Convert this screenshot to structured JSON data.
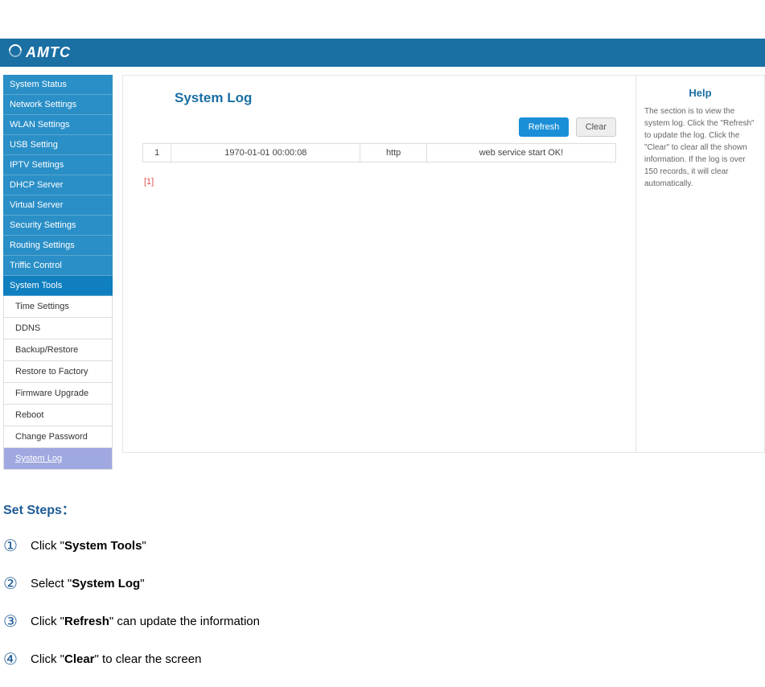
{
  "brand": "AMTC",
  "sidebar": {
    "items": [
      {
        "label": "System Status"
      },
      {
        "label": "Network Settings"
      },
      {
        "label": "WLAN Settings"
      },
      {
        "label": "USB Setting"
      },
      {
        "label": "IPTV Settings"
      },
      {
        "label": "DHCP Server"
      },
      {
        "label": "Virtual Server"
      },
      {
        "label": "Security Settings"
      },
      {
        "label": "Routing Settings"
      },
      {
        "label": "Triffic Control"
      },
      {
        "label": "System Tools"
      }
    ],
    "subitems": [
      {
        "label": "Time Settings"
      },
      {
        "label": "DDNS"
      },
      {
        "label": "Backup/Restore"
      },
      {
        "label": "Restore to Factory"
      },
      {
        "label": "Firmware Upgrade"
      },
      {
        "label": "Reboot"
      },
      {
        "label": "Change Password"
      },
      {
        "label": "System Log"
      }
    ]
  },
  "main": {
    "title": "System Log",
    "buttons": {
      "refresh": "Refresh",
      "clear": "Clear"
    },
    "log": {
      "row1": {
        "idx": "1",
        "time": "1970-01-01 00:00:08",
        "proto": "http",
        "msg": "web service start OK!"
      }
    },
    "pager": "[1]"
  },
  "help": {
    "title": "Help",
    "text": "The section is to view the system log. Click the \"Refresh\" to update the log. Click the \"Clear\" to clear all the shown information. If the log is over 150 records, it will clear automatically."
  },
  "steps": {
    "title": "Set Steps：",
    "nums": {
      "n1": "①",
      "n2": "②",
      "n3": "③",
      "n4": "④"
    },
    "s1": {
      "pre": "Click \"",
      "bold": "System Tools",
      "post": "\""
    },
    "s2": {
      "pre": "Select \"",
      "bold": "System Log",
      "post": "\""
    },
    "s3": {
      "pre": "Click \"",
      "bold": "Refresh",
      "post": "\" can update the information"
    },
    "s4": {
      "pre": "Click \"",
      "bold": "Clear",
      "post": "\" to clear the screen"
    }
  }
}
